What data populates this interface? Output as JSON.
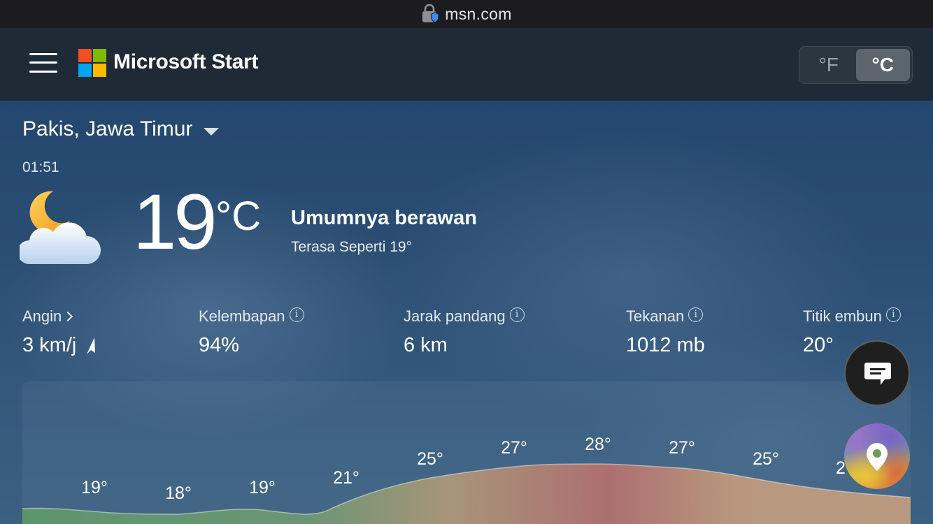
{
  "browser": {
    "url": "msn.com"
  },
  "header": {
    "brand": "Microsoft Start",
    "units": {
      "fahrenheit": "°F",
      "celsius": "°C",
      "selected": "celsius"
    }
  },
  "location": {
    "name": "Pakis, Jawa Timur"
  },
  "current": {
    "time": "01:51",
    "temperature": "19",
    "unit": "°C",
    "icon": "partly-cloudy-night-icon",
    "condition": "Umumnya berawan",
    "feels_like": "Terasa Seperti 19°"
  },
  "stats": [
    {
      "label": "Angin",
      "value": "3 km/j",
      "icon": "wind-direction-icon"
    },
    {
      "label": "Kelembapan",
      "value": "94%"
    },
    {
      "label": "Jarak pandang",
      "value": "6 km"
    },
    {
      "label": "Tekanan",
      "value": "1012 mb"
    },
    {
      "label": "Titik embun",
      "value": "20°"
    }
  ],
  "hourly_labels": [
    "19°",
    "18°",
    "19°",
    "21°",
    "25°",
    "27°",
    "28°",
    "27°",
    "25°",
    "2"
  ],
  "colors": {
    "appbar": "#1e2a35",
    "sky_top": "#24476f",
    "curve_cool": "#5f9a6a",
    "curve_warm": "#c79a78",
    "curve_hot": "#b86d6e"
  }
}
